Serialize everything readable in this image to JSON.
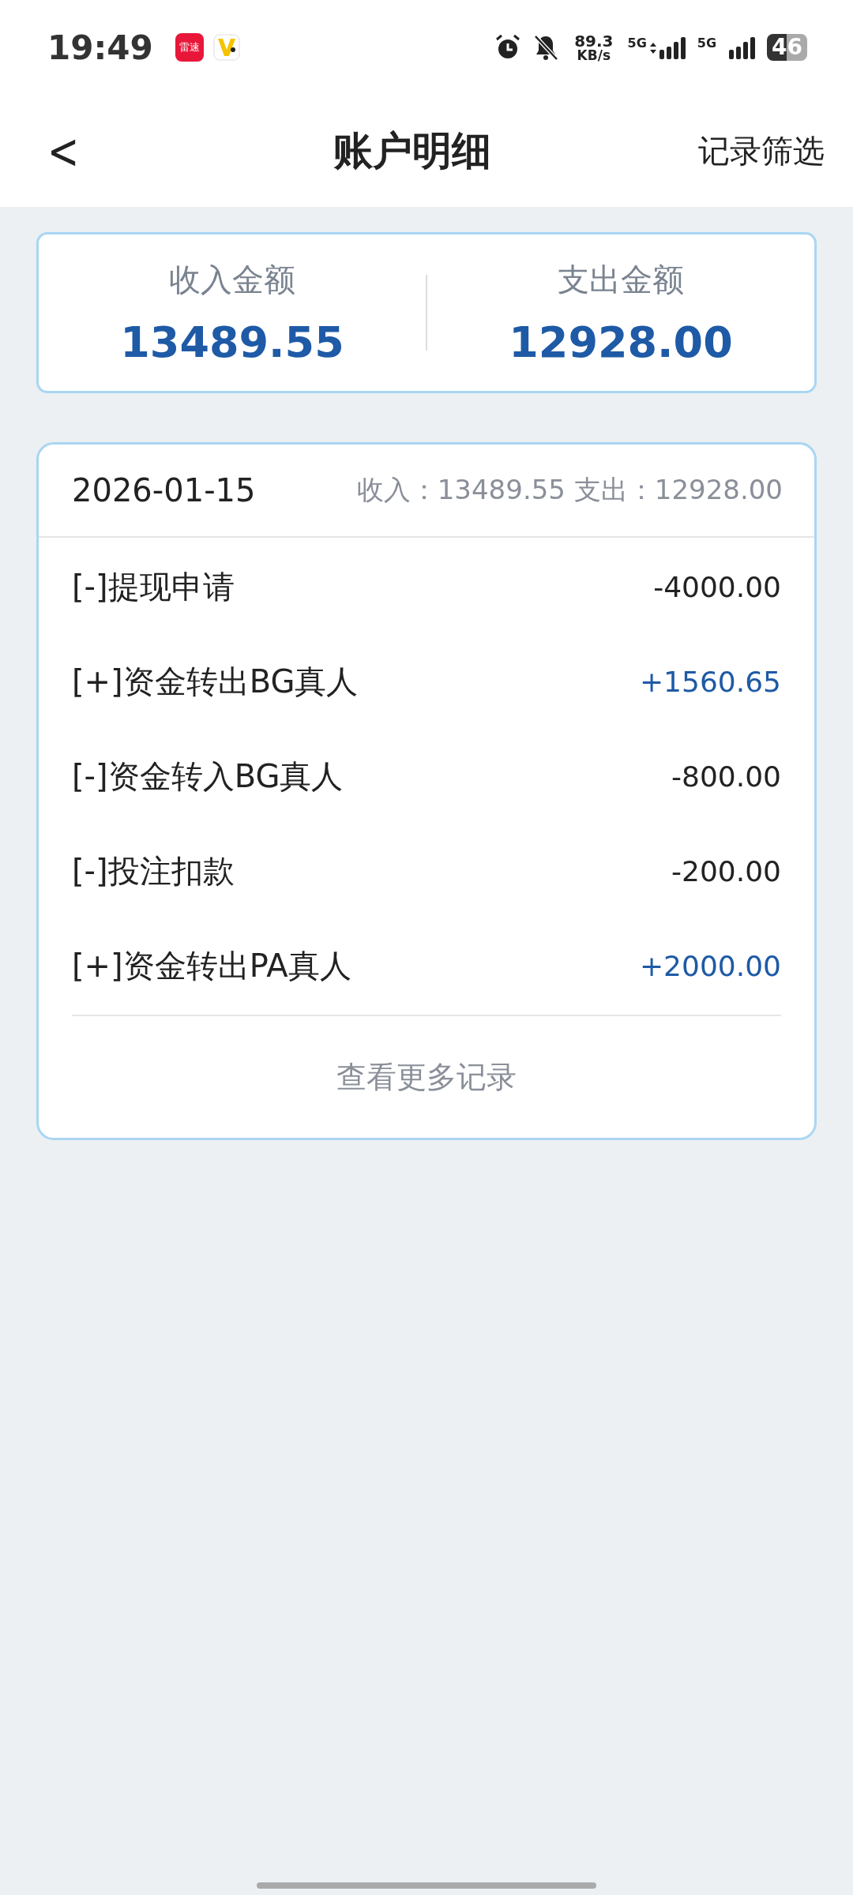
{
  "status_bar": {
    "time": "19:49",
    "app_icon_text": "雷速",
    "net_speed": "89.3",
    "net_unit": "KB/s",
    "networks": [
      {
        "label": "5G",
        "kind": "data"
      },
      {
        "label": "5G",
        "kind": "plain"
      }
    ],
    "battery": "46"
  },
  "nav": {
    "back": "<",
    "title": "账户明细",
    "action": "记录筛选"
  },
  "summary": [
    {
      "label": "收入金额",
      "amount": "13489.55"
    },
    {
      "label": "支出金额",
      "amount": "12928.00"
    }
  ],
  "day": {
    "date": "2026-01-15",
    "totals": "收入：13489.55 支出：12928.00",
    "records": [
      {
        "name": "[-]提现申请",
        "amount": "-4000.00",
        "kind": "expense"
      },
      {
        "name": "[+]资金转出BG真人",
        "amount": "+1560.65",
        "kind": "income"
      },
      {
        "name": "[-]资金转入BG真人",
        "amount": "-800.00",
        "kind": "expense"
      },
      {
        "name": "[-]投注扣款",
        "amount": "-200.00",
        "kind": "expense"
      },
      {
        "name": "[+]资金转出PA真人",
        "amount": "+2000.00",
        "kind": "income"
      }
    ],
    "more": "查看更多记录"
  }
}
